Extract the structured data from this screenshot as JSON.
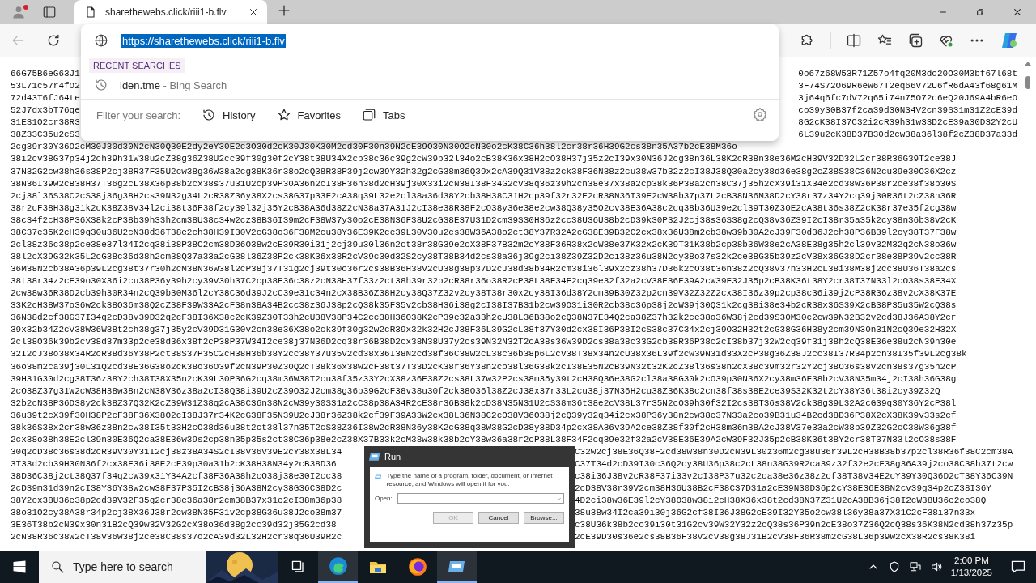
{
  "browser": {
    "tabs": [
      {
        "title": "sharethewebs.click/riii1-b.flv",
        "selected": true
      }
    ],
    "back_disabled": true,
    "address": {
      "url": "https://sharethewebs.click/riii1-b.flv",
      "highlighted": true
    },
    "suggestions": {
      "heading": "RECENT SEARCHES",
      "items": [
        {
          "text": "iden.tme",
          "suffix": "- Bing Search"
        }
      ]
    },
    "filter": {
      "label": "Filter your search:",
      "options": [
        {
          "kind": "history",
          "label": "History"
        },
        {
          "kind": "favorites",
          "label": "Favorites"
        },
        {
          "kind": "tabs",
          "label": "Tabs"
        }
      ]
    }
  },
  "page": {
    "lines": [
      {
        "kind": "under_dropdown",
        "left": "66G75B6eG63J1",
        "right": "0o67z68W53R71Z57o4fq20M3do20O30M3bf67l68t"
      },
      {
        "kind": "under_dropdown",
        "left": "53L71c57r4fO2",
        "right": "3F74S72O69R6eW67T2eq66V72U6fR6dA43f68g61M"
      },
      {
        "kind": "under_dropdown",
        "left": "72d43T6fJ64te",
        "right": "3j64q6fc7dV72q65i74n75O72c6eQ20J69A4bR6eO"
      },
      {
        "kind": "under_dropdown",
        "left": "52J7dx3bT76qe",
        "right": "co39y30B37f2ca39d30N34V2cn39S31m31Z2cE39d"
      },
      {
        "kind": "under_dropdown",
        "left": "31E31O2cr38R3",
        "right": "8G2cK38I37C32i2cR39h31w33D2cE39a30D32Y2cU"
      },
      {
        "kind": "under_dropdown",
        "left": "38Z33C35u2cS3",
        "right": "6L39u2cK38D37B30d2cw38a36l38f2cZ38D37a33d"
      },
      {
        "kind": "full",
        "text": "2cg39r30Y36O2cM30J30d30N2cN30Q30E2dy2eY30E2c3O30d2cK30J30K30M2cd30F30n39N2cE39O30N30O2cN30o2cK38C36h38l2cr38r36H39G2cs38n35A37b2cE38M36o"
      },
      {
        "kind": "full",
        "text": "38i2cv38G37p34j2ch39h31W38u2cZ38g36Z38U2cc39f30g30f2cY38t38U34X2cb38c36c39g2cW39b32l34o2cB38K36x38H2cO38H37j35z2cI39x30N36J2cg38n36L38K2cR38n38e36M2cH39V32D32L2cr38R36G39T2ce38J"
      },
      {
        "kind": "full",
        "text": "37N32G2cw38h36s38P2cj38R37F35U2cw38g36W38a2cg38K36r38o2cQ38R38P39j2cw39Y32h32g2cG38m36Q39x2cA39Q31V38z2ck38F36N38z2cu38w37b32z2cI38J38Q30a2cy38d36e38g2cZ38S38C36N2cu39e30O36X2cz"
      },
      {
        "kind": "full",
        "text": "38N36I39w2cB38H37T36g2cL38X36p38b2cx38s37u31U2cp39P30A36n2cI38H36h38d2cH39j30X33i2cN38I38F34G2cv38q36z39h2cn38e37x38a2cp38k36P38a2cn38C37j35h2cX39i31X34e2cd38W36P38r2ce38f38p30S"
      },
      {
        "kind": "full",
        "text": "2cj38l36S38C2cS38j36g38H2cs39N32g34L2cR38Z36y38X2cs38G37p33F2cA38q39L32e2cl38a36d38Y2cb38H38C31H2cp39f32r32E2cR38N36I39E2cW38b37p37L2cB38N36M38D2cY38r37z34Y2cq39j30R36t2cZ38n36R"
      },
      {
        "kind": "full",
        "text": "38r2cF38H38g31k2cK38Z38V34l2ci38t36F38f2cy39l32j35Y2cB38A36d38Z2cN38a37A31J2cI38e38R38F2cO38y36e38e2cw38Q38y35O2cv38E36A38c2cq38b36U39e2cl39T30Z30E2cA38t36s38Z2cK38r37e35f2cg38w"
      },
      {
        "kind": "full",
        "text": "38c34f2cH38P36X38k2cP38b39h33h2cm38U38c34w2cz38B36I39m2cF38W37y30o2cE38N36F38U2cG38E37U31D2cm39S30H36z2cc38U36U38b2cD39k30P32J2cj38s36S38g2cQ38v36Z39I2cI38r35a35k2cy38n36b38v2cK"
      },
      {
        "kind": "full",
        "text": "38C37e35K2cH39g30u36U2cN38d36T38e2ch38H39I30V2cG38o36F38M2cu38Y36E39K2ce39L30V30u2cs38W36A38o2ct38Y37R32A2cG38E39B32C2cx38x36U38m2cb38w39b30A2cJ39F30d36J2ch38P36B39l2cy38T37F38w"
      },
      {
        "kind": "full",
        "text": "2cl38z36c38p2ce38e37l34I2cq38i38P38C2cm38D36O38w2cE39R30i31j2cj39u30l36n2ct38r38G39e2cX38F37B32m2cY38F36R38x2cW38e37K32x2cK39T31K38b2cp38b36W38e2cA38E38g35h2cl39v32M32q2cN38o36w"
      },
      {
        "kind": "full",
        "text": "38l2cX39G32k35L2cG38c36d38h2cm38Q37a33a2cG38l36Z38P2ck38K36x38R2cV39c30d32S2cy38T38B34d2cs38a36j39g2ci38Z39Z32D2ci38z36u38N2cy38o37s32k2ce38G35b39z2cV38x36G38D2cr38e38P39v2cc38R"
      },
      {
        "kind": "full",
        "text": "36M38N2cb38A36p39L2cg38t37r30h2cM38N36W38l2cP38j37T31g2cj39t30o36r2cs38B36H38v2cU38g38p37D2cJ38d38b34R2cm38i36l39x2cz38h37D36k2cO38t36n38z2cQ38V37n33H2cL38i38M38j2cc38U36T38a2cs"
      },
      {
        "kind": "full",
        "text": "38t38r34z2cE39o30X36i2cu38P36y39h2cy39V30h37C2cp38E36c38z2cN38H37f33z2ct38h39r32b2cR38r36o38R2cP38L38F34F2cq39e32f32a2cV38E36E39A2cW39F32J35p2cB38K36t38Y2cr38T37N33l2cO38s38F34X"
      },
      {
        "kind": "full",
        "text": "2cw38w36R38D2cb39h30R34n2cQ39b30M36l2cY38C36d39J2cC39e31c34n2cX38B36Z38H2cy38Q37Z32v2cy38T38r30x2cy38I36d38Y2cm39B30Z32p2cn39V32Z32Z2cx38I36z39p2cp38c36i39j2cP38R36z38v2cX38K37E"
      },
      {
        "kind": "full",
        "text": "33K2cH38W37o36w2ck38O36m38Q2cZ38F39W33A2cF38n38A34B2cc38z36J38p2cQ38k35F35v2cb38H36i38g2cI38I37B31b2cw39O31i30R2cb38c36p38j2cW39j30Q31k2cg38i38e34b2cR38x36S39X2cB38P35u35W2cQ38s"
      },
      {
        "kind": "full",
        "text": "36N38d2cf38G37I34q2cD38v39D32q2cF38I36X38c2cK39Z30T33h2cU38V38P34C2cc38H36O38K2cP39e32a33h2cU38L36B38o2cQ38N37E34Q2ca38Z37h32k2ce38o36W38j2cd39S30M30c2cw39N32B32v2cd38J36A38Y2cr"
      },
      {
        "kind": "full",
        "text": "39x32b34Z2cV38W36W38t2ch38g37j35y2cV39D31G30v2cn38e36X38o2ck39f30g32w2cR39x32k32H2cJ38F36L39G2cL38f37Y30d2cx38I36P38I2cS38c37C34x2cj39O32H32t2cG38G36H38y2cm39N30n31N2cQ39e32H32X"
      },
      {
        "kind": "full",
        "text": "2cl38O36k39b2cv38d37m33p2ce38d36x38f2cP38P37W34I2ce38j37N36D2cq38r36B38D2cx38N38U37y2cs39N32N32T2cA38s36W39D2cs38a38c33G2cb38R36P38c2cI38b37j32W2cq39f31j38h2cQ38E36e38u2cN39h30e"
      },
      {
        "kind": "full",
        "text": "32I2cJ38o38x34R2cR38d36Y38P2ct38S37P35C2cH38H36b38Y2cc38Y37u35V2cd38x36I38N2cd38f36C38w2cL38c36b38p6L2cv38T38x34n2cU38x36L39f2cw39N31d33X2cP38g36Z38J2cc38I37R34p2cn38I35f39L2cg38k"
      },
      {
        "kind": "full",
        "text": "36o38m2ca39j30L31Q2cd38E36G38o2cK38o36O39f2cN39P30Z30Q2cT38k36x38w2cF38t37T33D2cK38r36Y38n2co38l36G38k2cI38E35N2cB39N32t32K2cZ38l36s38n2cX38c39m32r32Y2cj38O36s38v2cn38s37g35h2cP"
      },
      {
        "kind": "full",
        "text": "39H31G30d2cg38T36z38Y2ch38T38X35n2cK39L30P36G2cq38m36W38T2cu38f35z33Y2cX38z36E38Z2cs38L37w32P2cs38m35y39t2cH38Q36e38G2cl38a38G30k2cO39p30N36X2cy38m36F38b2cV38N35m34j2cI38h36G38g"
      },
      {
        "kind": "full",
        "text": "2cO38Z37g31W2cW38H38w38n2cN38V36z38a2cI38Q38i39U2cZ39O32J2cm38g36b39G2cF38v38u30f2ck38O36l38Z2cJ38x37r33L2cu38j37N36H2cu38Z36K38c2cn38f38s38E2ce39S32K32t2cY38Y36t38i2cy39Z32Q"
      },
      {
        "kind": "full",
        "text": "32b2cN38P36D38y2ck38Z37Q32K2cZ39W31Z38q2cA38C36n38N2cW39y30S31a2cC38p38A34R2cE38r36B38k2cD38N35N31U2cS38m36t38e2cV38L37r35N2cO39h30f32I2cs38T36s38V2ck38g39L32A2cG39q30Y36Y2cP38l"
      },
      {
        "kind": "full",
        "text": "36u39t2cX39f30H38P2cF38F36X38O2cI38J37r34K2cG38F35N39U2cJ38r36Z38k2cf39F39A33W2cx38L36N38C2cO38V36O38j2cQ39y32q34i2cx38P36y38n2cw38e37N33a2co39B31u34B2cd38D36P38X2cX38K39v33s2cf"
      },
      {
        "kind": "full",
        "text": "38k36S38x2cr38w36z38n2cw38I35t33H2cO38d36u38t2ct38l37n35T2cS38Z36I38w2cR38N36y38K2cG38q38W38G2cD38y38D34p2cx38A36v39A2ce38Z38f30f2cH38m36m38A2cJ38V37e33a2cW38b39Z32G2cC38W36g38f"
      },
      {
        "kind": "full",
        "text": "2cx38o38h38E2cl39n30E36Q2ca38E36w39s2cp38n35p35s2ct38C36p38e2cZ38X37B33k2cM38w38k38b2cY38w36a38r2cP38L38F34F2cq39e32f32a2cV38E36E39A2cW39F32J35p2cB38K36t38Y2cr38T37N33l2cO38s38F"
      },
      {
        "kind": "under_dialog",
        "left": "30q2cD38c36s38d2cR39V30Y31I2cj38z38A34S2cI38V36v39E2cY38x38L34",
        "right": "C32w2cj38E36Q38F2cd38w38n30D2cN39L30z36m2cg38u36r39L2cH38B38b37p2cl38R36f38C2cm38A"
      },
      {
        "kind": "under_dialog",
        "left": "3T33d2cb39H30N36f2cx38E36i38E2cF39p30a31b2cK38H38N34y2cB38D36",
        "right": "C37T34d2cD39I30c36Q2cy38U36p38c2cL38n38G39R2ca39z32f32e2cF38g36A39j2co38C38h37t2cw"
      },
      {
        "kind": "under_dialog",
        "left": "38D36C38j2ct38Q37f34q2cW39x31Y34A2cf38F36A38h2cO38j38e30I2cc38",
        "right": "c38i36J38v2cR38F37i33v2cI38P37u32c2ca38e36z38z2cf38T38V34E2cY39Y30Q36D2cT38Y36C39N"
      },
      {
        "kind": "under_dialog",
        "left": "2cD39m31d39n2cI38Y36Y38w2cw38F37P35I2cB38j36A38N2cy38G36C38D2c",
        "right": "2cD38V38r39V2cm38H36U38B2cF38C37D31a2cE39N30D36p2cY38E36E38N2cv39g34p2cZ38I36Y"
      },
      {
        "kind": "under_dialog",
        "left": "38Y2cx38U36e38p2cd39V32F35g2cr38e36a38r2cm38B37x31e2cI38m36p38",
        "right": "4D2ci38w36E39l2cY38O38w38i2cH38X36x38t2cd38N37Z31U2cA38B36j38I2cW38U36e2co38Q"
      },
      {
        "kind": "under_dialog",
        "left": "38o31O2cy38A38r34p2cj38X36J38r2cw38N35F31v2cp38G36u38J2co38m37",
        "right": "38u38w34I2ca39i30j36G2cf38I36J38G2cE39I32Y35o2cw38l36y38a37X31C2cF38i37n33x"
      },
      {
        "kind": "under_dialog",
        "left": "3E36T38b2cN39x30n31B2cQ39w32V32G2cX38o36d38g2cc39d32j35G2cd38",
        "right": "c38U36k38b2co39i30t31G2cv39W32Y32z2cQ38s36P39n2cE38o37Z36Q2cQ38s36K38N2cd38h37z35p"
      },
      {
        "kind": "under_dialog",
        "left": "2cN38R36c38W2cT38v36w38j2ce38C38s37o2cA39d32L32H2cr38q36U39R2c",
        "right": "2cE39D30s36e2cs38B36F38V2cv38g38J31B2cv38F36R38m2cG38L36p39W2cX38R2cs38K38i"
      }
    ]
  },
  "run_dialog": {
    "title": "Run",
    "message": "Type the name of a program, folder, document, or Internet resource, and Windows will open it for you.",
    "open_label": "Open:",
    "buttons": [
      {
        "label": "OK",
        "disabled": true
      },
      {
        "label": "Cancel",
        "disabled": false
      },
      {
        "label": "Browse...",
        "disabled": false
      }
    ]
  },
  "taskbar": {
    "search_placeholder": "Type here to search",
    "apps": [
      {
        "kind": "taskview",
        "selected": false
      },
      {
        "kind": "edge",
        "selected": true
      },
      {
        "kind": "explorer",
        "selected": false
      },
      {
        "kind": "firefox",
        "selected": false
      },
      {
        "kind": "run",
        "selected": true
      }
    ],
    "time": "2:00 PM",
    "date": "1/13/2025"
  }
}
